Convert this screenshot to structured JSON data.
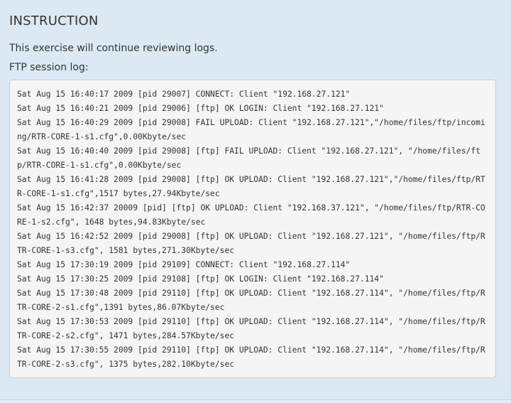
{
  "instruction": {
    "heading": "INSTRUCTION",
    "intro": "This exercise will continue reviewing logs.",
    "log_label": "FTP session log:"
  },
  "log": {
    "lines": [
      "Sat Aug 15 16:40:17 2009 [pid 29007] CONNECT: Client \"192.168.27.121\"",
      "Sat Aug 15 16:40:21 2009 [pid 29006] [ftp] OK LOGIN: Client \"192.168.27.121\"",
      "Sat Aug 15 16:40:29 2009 [pid 29008] FAIL UPLOAD: Client \"192.168.27.121\",\"/home/files/ftp/incoming/RTR-CORE-1-s1.cfg\",0.00Kbyte/sec",
      "Sat Aug 15 16:40:40 2009 [pid 29008] [ftp] FAIL UPLOAD: Client \"192.168.27.121\", \"/home/files/ftp/RTR-CORE-1-s1.cfg\",0.00Kbyte/sec",
      "Sat Aug 15 16:41:28 2009 [pid 29008] [ftp] OK UPLOAD: Client \"192.168.27.121\",\"/home/files/ftp/RTR-CORE-1-s1.cfg\",1517 bytes,27.94Kbyte/sec",
      "Sat Aug 15 16:42:37 20009 [pid] [ftp] OK UPLOAD: Client \"192.168.37.121\", \"/home/files/ftp/RTR-CORE-1-s2.cfg\", 1648 bytes,94.83Kbyte/sec",
      "Sat Aug 15 16:42:52 2009 [pid 29008] [ftp] OK UPLOAD: Client \"192.168.27.121\", \"/home/files/ftp/RTR-CORE-1-s3.cfg\", 1581 bytes,271.30Kbyte/sec",
      "Sat Aug 15 17:30:19 2009 [pid 29109] CONNECT: Client \"192.168.27.114\"",
      "Sat Aug 15 17:30:25 2009 [pid 29108] [ftp] OK LOGIN: Client \"192.168.27.114\"",
      "Sat Aug 15 17:30:48 2009 [pid 29110] [ftp] OK UPLOAD: Client \"192.168.27.114\", \"/home/files/ftp/RTR-CORE-2-s1.cfg\",1391 bytes,86.07Kbyte/sec",
      "Sat Aug 15 17:30:53 2009 [pid 29110] [ftp] OK UPLOAD: Client \"192.168.27.114\", \"/home/files/ftp/RTR-CORE-2-s2.cfg\", 1471 bytes,284.57Kbyte/sec",
      "Sat Aug 15 17:30:55 2009 [pid 29110] [ftp] OK UPLOAD: Client \"192.168.27.114\", \"/home/files/ftp/RTR-CORE-2-s3.cfg\", 1375 bytes,282.10Kbyte/sec"
    ]
  }
}
